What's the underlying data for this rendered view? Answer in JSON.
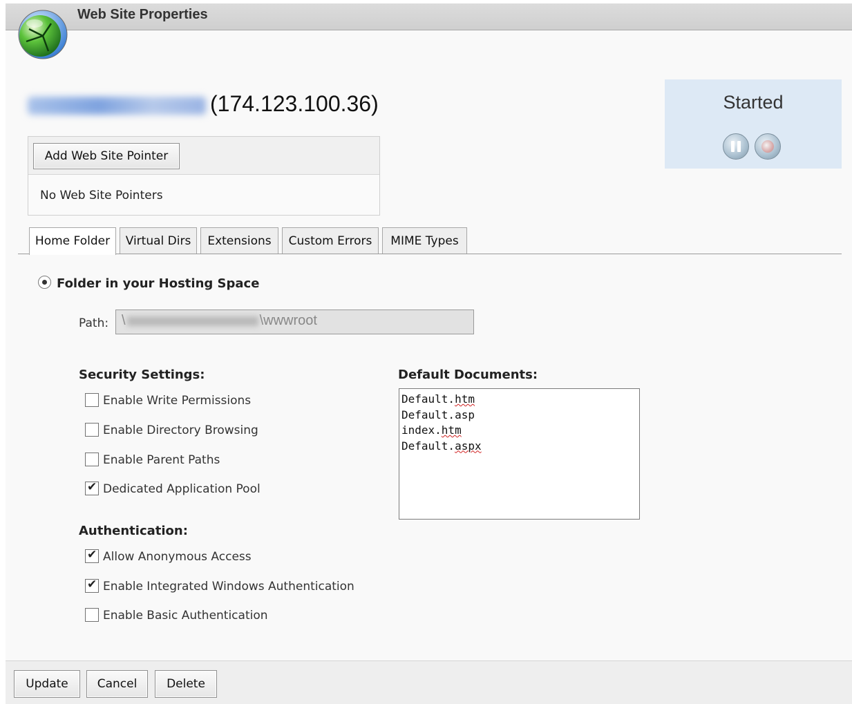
{
  "window": {
    "title": "Web Site Properties"
  },
  "site": {
    "ip": "(174.123.100.36)"
  },
  "status": {
    "state": "Started",
    "pause_icon": "pause-icon",
    "stop_icon": "stop-icon"
  },
  "pointers": {
    "add_button": "Add Web Site Pointer",
    "empty_text": "No Web Site Pointers"
  },
  "tabs": [
    {
      "label": "Home Folder",
      "active": true
    },
    {
      "label": "Virtual Dirs"
    },
    {
      "label": "Extensions"
    },
    {
      "label": "Custom Errors"
    },
    {
      "label": "MIME Types"
    }
  ],
  "home_folder": {
    "option_label": "Folder in your Hosting Space",
    "path_label": "Path:",
    "path_prefix": "\\",
    "path_suffix": "\\wwwroot"
  },
  "security": {
    "heading": "Security Settings:",
    "options": [
      {
        "label": "Enable Write Permissions",
        "checked": false
      },
      {
        "label": "Enable Directory Browsing",
        "checked": false
      },
      {
        "label": "Enable Parent Paths",
        "checked": false
      },
      {
        "label": "Dedicated Application Pool",
        "checked": true
      }
    ]
  },
  "authentication": {
    "heading": "Authentication:",
    "options": [
      {
        "label": "Allow Anonymous Access",
        "checked": true
      },
      {
        "label": "Enable Integrated Windows Authentication",
        "checked": true
      },
      {
        "label": "Enable Basic Authentication",
        "checked": false
      }
    ]
  },
  "default_documents": {
    "heading": "Default Documents:",
    "items": [
      {
        "name": "Default.",
        "ext": "htm"
      },
      {
        "name": "Default.asp",
        "ext": ""
      },
      {
        "name": "index.",
        "ext": "htm"
      },
      {
        "name": "Default.",
        "ext": "aspx"
      }
    ]
  },
  "footer": {
    "update": "Update",
    "cancel": "Cancel",
    "delete": "Delete"
  },
  "colors": {
    "status_bg": "#dde9f5",
    "title_bg": "#d4d4d4",
    "footer_bg": "#eeeeee"
  }
}
